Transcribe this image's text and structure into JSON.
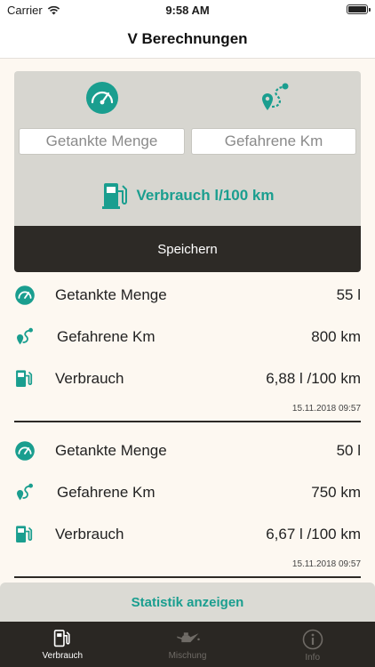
{
  "status_bar": {
    "carrier": "Carrier",
    "time": "9:58 AM"
  },
  "nav": {
    "title": "V Berechnungen"
  },
  "inputs": {
    "fuel_placeholder": "Getankte Menge",
    "distance_placeholder": "Gefahrene Km",
    "result_label": "Verbrauch l/100 km"
  },
  "save_label": "Speichern",
  "records": [
    {
      "fuel_label": "Getankte Menge",
      "fuel_value": "55 l",
      "distance_label": "Gefahrene Km",
      "distance_value": "800 km",
      "consumption_label": "Verbrauch",
      "consumption_value": "6,88 l /100 km",
      "timestamp": "15.11.2018 09:57"
    },
    {
      "fuel_label": "Getankte Menge",
      "fuel_value": "50 l",
      "distance_label": "Gefahrene Km",
      "distance_value": "750 km",
      "consumption_label": "Verbrauch",
      "consumption_value": "6,67 l /100 km",
      "timestamp": "15.11.2018 09:57"
    }
  ],
  "stats_label": "Statistik anzeigen",
  "tabs": [
    {
      "label": "Verbrauch",
      "icon": "fuel-pump-icon"
    },
    {
      "label": "Mischung",
      "icon": "oil-can-icon"
    },
    {
      "label": "Info",
      "icon": "info-icon"
    }
  ],
  "colors": {
    "accent": "#1a9e8f",
    "dark": "#2d2a26",
    "panel": "#d7d6d0",
    "background": "#fdf8f1"
  }
}
